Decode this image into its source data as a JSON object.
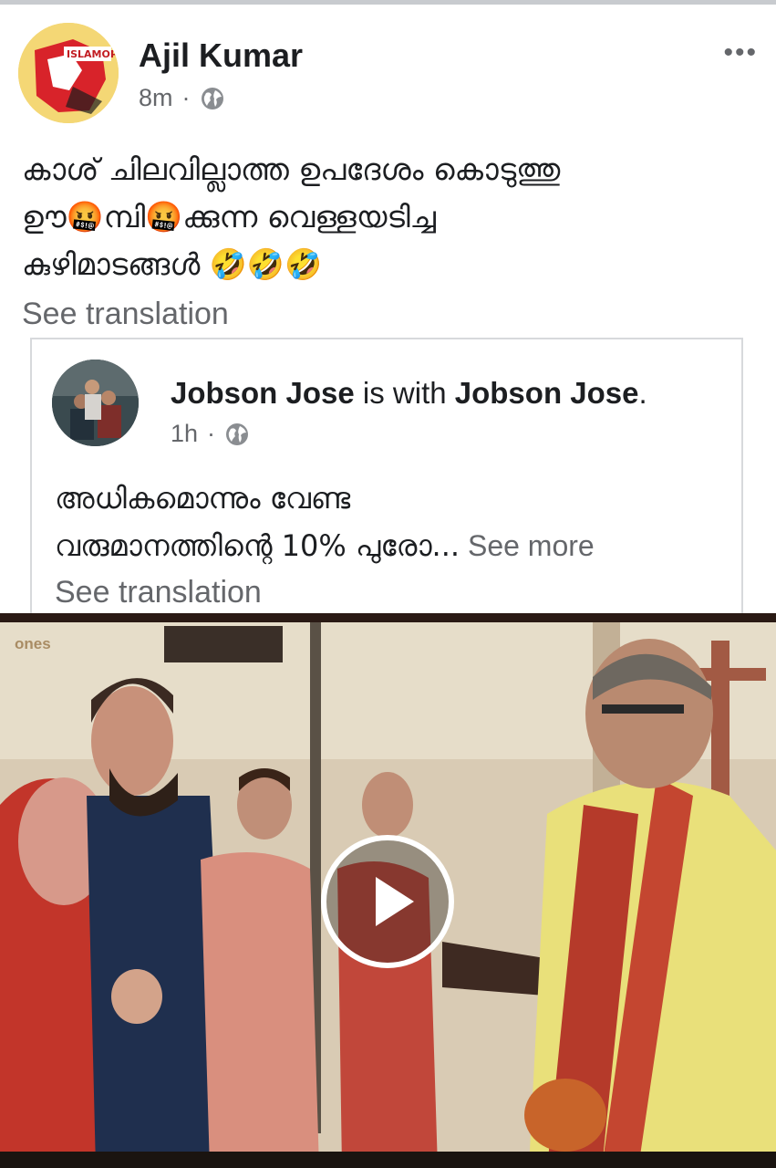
{
  "post": {
    "author": "Ajil Kumar",
    "time": "8m",
    "separator": "·",
    "privacy_icon": "globe-icon",
    "more_icon": "more-options-icon",
    "more_label": "•••",
    "text": "കാശ് ചിലവില്ലാത്ത ഉപദേശം കൊടുത്തു\nഊ🤬മ്പി🤬ക്കുന്ന  വെള്ളയടിച്ച\nകുഴിമാടങ്ങൾ 🤣🤣🤣",
    "see_translation": "See translation"
  },
  "shared": {
    "author": "Jobson Jose",
    "with_text": " is with ",
    "with_author": "Jobson Jose",
    "period": ".",
    "time": "1h",
    "separator": "·",
    "privacy_icon": "globe-icon",
    "text_line1": "അധികമൊന്നും വേണ്ട",
    "text_line2": "വരുമാനത്തിന്റെ 10% പുരോ...",
    "see_more": " See more",
    "see_translation": "See translation"
  },
  "video": {
    "watermark": "ones",
    "play_icon": "play-icon"
  },
  "colors": {
    "text": "#1c1e21",
    "secondary": "#65676b",
    "divider": "#d7d9dc"
  }
}
